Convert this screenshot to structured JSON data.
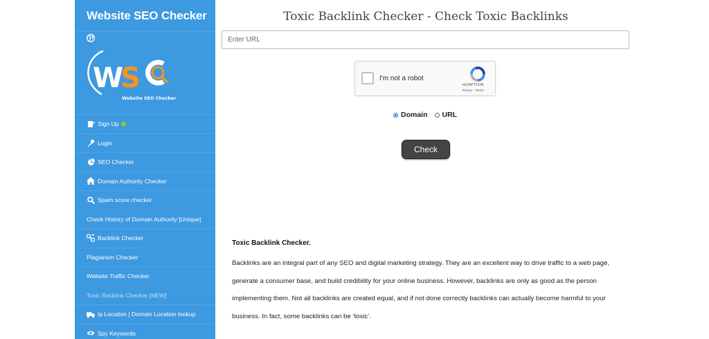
{
  "sidebar": {
    "brand": "Website SEO Checker",
    "logo_text": "WSC",
    "logo_sub": "Website SEO Checker",
    "items": [
      {
        "label": "Sign Up",
        "icon": "signup-icon"
      },
      {
        "label": "Login",
        "icon": "key-icon"
      },
      {
        "label": "SEO Checker",
        "icon": "pie-chart-icon"
      },
      {
        "label": "Domain Authority Checker",
        "icon": "home-icon"
      },
      {
        "label": "Spam score checker",
        "icon": "search-icon"
      },
      {
        "label": "Check History of Domain Authority [Unique]",
        "icon": ""
      },
      {
        "label": "Backlink Checker",
        "icon": "link-icon"
      },
      {
        "label": "Plagiarism Checker",
        "icon": ""
      },
      {
        "label": "Website Traffic Checker",
        "icon": ""
      },
      {
        "label": "Toxic Backlink Checker [NEW]",
        "icon": "",
        "active": true
      },
      {
        "label": "Ip Location | Domain Location lookup",
        "icon": "truck-icon"
      },
      {
        "label": "Spy Keywords",
        "icon": "eye-icon"
      }
    ]
  },
  "main": {
    "title": "Toxic Backlink Checker - Check Toxic Backlinks",
    "url_placeholder": "Enter URL",
    "url_value": "",
    "captcha": {
      "label": "I'm not a robot",
      "brand": "reCAPTCHA",
      "links": "Privacy - Terms"
    },
    "radio_options": [
      {
        "label": "Domain",
        "checked": true
      },
      {
        "label": "URL",
        "checked": false
      }
    ],
    "check_label": "Check",
    "article": {
      "heading": "Toxic Backlink Checker.",
      "body": "Backlinks are an integral part of any SEO and digital marketing strategy. They are an excellent way to drive traffic to a web page, generate a consumer base, and build credibility for your online business. However, backlinks are only as good as the person implementing them. Not all backlinks are created equal, and if not done correctly backlinks can actually become harmful to your business. In fact, some backlinks can be ‘toxic’."
    }
  },
  "colors": {
    "sidebar_bg": "#3d99e0",
    "button_bg": "#444444",
    "logo_orange": "#f7941d",
    "radio_accent": "#1a73e8"
  }
}
